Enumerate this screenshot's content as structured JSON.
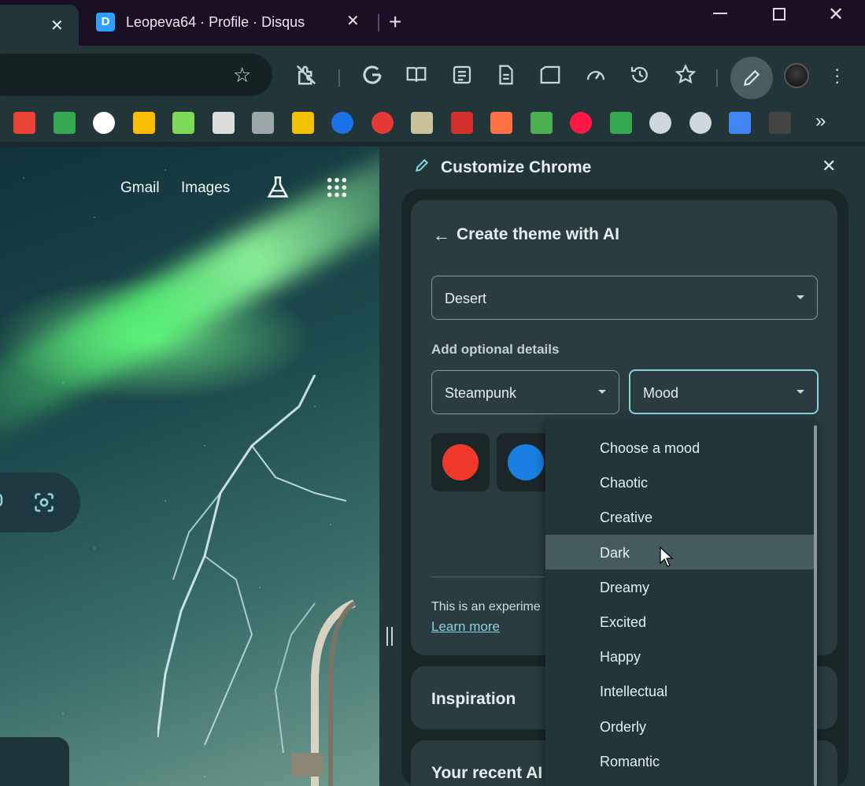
{
  "browser": {
    "tabs": [
      {
        "title": "",
        "close": "✕"
      },
      {
        "title": "Leopeva64 · Profile · Disqus",
        "favicon": "D",
        "close": "✕"
      }
    ],
    "new_tab": "+",
    "window_controls": {
      "close": "✕"
    }
  },
  "toolbar": {
    "icons": [
      "bookmark-star-icon",
      "extension-icon",
      "google-icon",
      "reading-mode-icon",
      "reading-list-icon",
      "document-icon",
      "tab-search-icon",
      "performance-icon",
      "history-icon",
      "bookmarks-icon",
      "customize-pen-icon",
      "profile-avatar",
      "menu-kebab-icon"
    ]
  },
  "bookmarks": {
    "colors": [
      "#ea4335",
      "#34a853",
      "#ffffff",
      "#fbbc05",
      "#7ed957",
      "#dddddd",
      "#9aa6a8",
      "#f2c200",
      "#1a73e8",
      "#e53935",
      "#c8c19a",
      "#d32f2f",
      "#ff7043",
      "#4caf50",
      "#ff1744",
      "#34a853",
      "#cfd8dc",
      "#cfd8dc",
      "#4285f4",
      "#444444"
    ],
    "overflow": "»"
  },
  "page": {
    "links": {
      "gmail": "Gmail",
      "images": "Images"
    }
  },
  "panel": {
    "title": "Customize Chrome",
    "card": {
      "title": "Create theme with AI",
      "subject_select": "Desert",
      "optional_label": "Add optional details",
      "style_select": "Steampunk",
      "mood_select": "Mood",
      "swatch_colors": [
        "#ef3a2b",
        "#1a7fe0"
      ],
      "disclaimer": "This is an experime",
      "learn_more": "Learn more"
    },
    "inspiration_title": "Inspiration",
    "recent_title": "Your recent AI"
  },
  "mood_menu": {
    "options": [
      "Choose a mood",
      "Chaotic",
      "Creative",
      "Dark",
      "Dreamy",
      "Excited",
      "Happy",
      "Intellectual",
      "Orderly",
      "Romantic"
    ],
    "hovered": "Dark"
  }
}
